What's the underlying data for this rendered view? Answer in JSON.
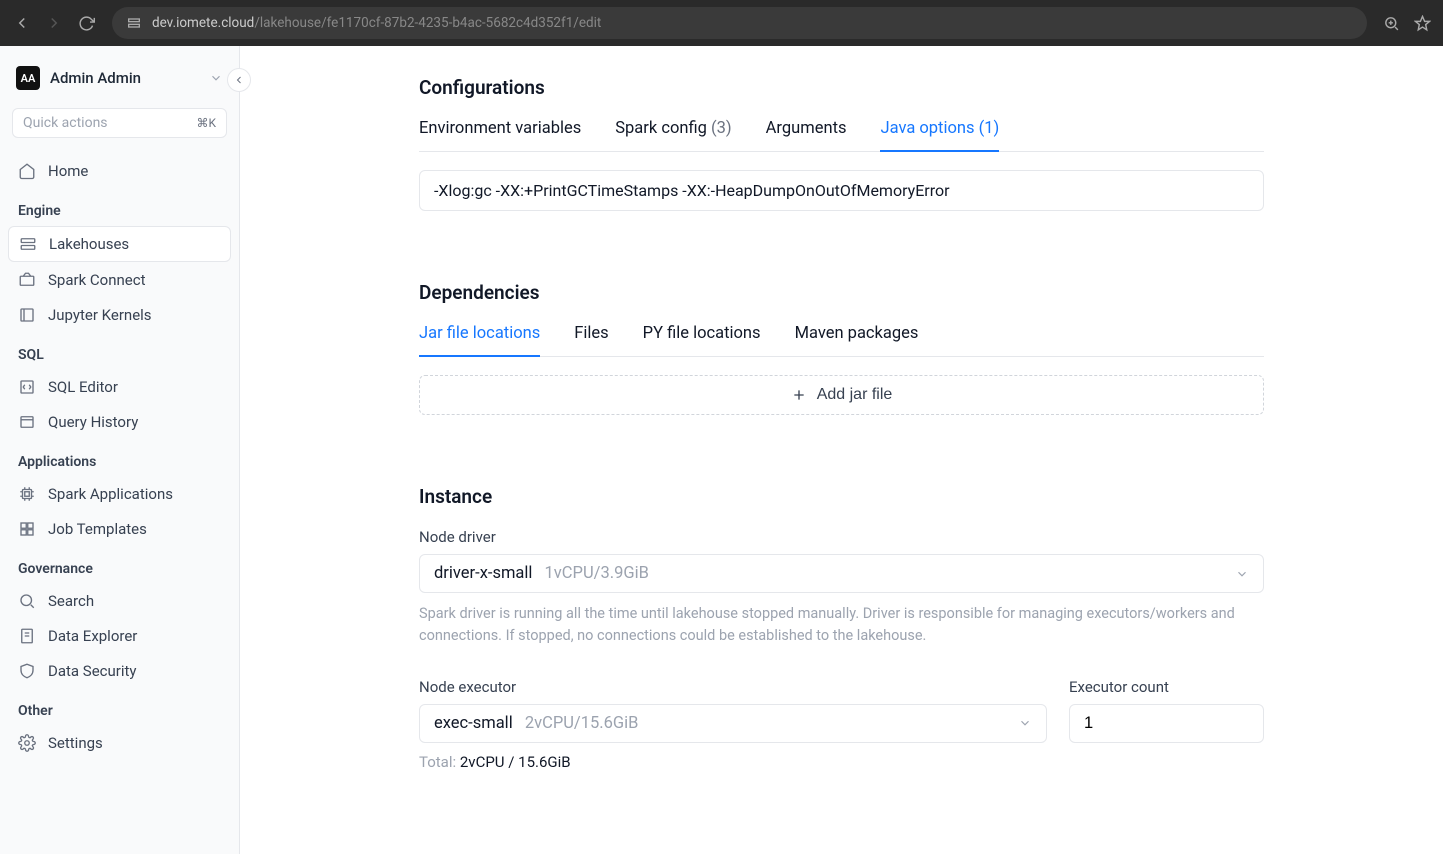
{
  "browser": {
    "url_host": "dev.iomete.cloud",
    "url_path": "/lakehouse/fe1170cf-87b2-4235-b4ac-5682c4d352f1/edit"
  },
  "user": {
    "initials": "AA",
    "name": "Admin Admin"
  },
  "search": {
    "placeholder": "Quick actions",
    "shortcut": "⌘K"
  },
  "sidebar": {
    "home": "Home",
    "groups": {
      "engine": {
        "label": "Engine",
        "items": [
          "Lakehouses",
          "Spark Connect",
          "Jupyter Kernels"
        ]
      },
      "sql": {
        "label": "SQL",
        "items": [
          "SQL Editor",
          "Query History"
        ]
      },
      "apps": {
        "label": "Applications",
        "items": [
          "Spark Applications",
          "Job Templates"
        ]
      },
      "gov": {
        "label": "Governance",
        "items": [
          "Search",
          "Data Explorer",
          "Data Security"
        ]
      },
      "other": {
        "label": "Other",
        "items": [
          "Settings"
        ]
      }
    }
  },
  "config": {
    "title": "Configurations",
    "tabs": {
      "env": "Environment variables",
      "spark": "Spark config",
      "spark_count": "(3)",
      "args": "Arguments",
      "java": "Java options",
      "java_count": "(1)"
    },
    "java_value": "-Xlog:gc -XX:+PrintGCTimeStamps -XX:-HeapDumpOnOutOfMemoryError"
  },
  "deps": {
    "title": "Dependencies",
    "tabs": {
      "jar": "Jar file locations",
      "files": "Files",
      "py": "PY file locations",
      "maven": "Maven packages"
    },
    "add_label": "Add jar file"
  },
  "instance": {
    "title": "Instance",
    "driver": {
      "label": "Node driver",
      "value": "driver-x-small",
      "spec": "1vCPU/3.9GiB",
      "helper": "Spark driver is running all the time until lakehouse stopped manually. Driver is responsible for managing executors/workers and connections. If stopped, no connections could be established to the lakehouse."
    },
    "executor": {
      "label": "Node executor",
      "value": "exec-small",
      "spec": "2vCPU/15.6GiB",
      "count_label": "Executor count",
      "count_value": "1",
      "total_label": "Total:",
      "total_value": "2vCPU / 15.6GiB"
    }
  }
}
